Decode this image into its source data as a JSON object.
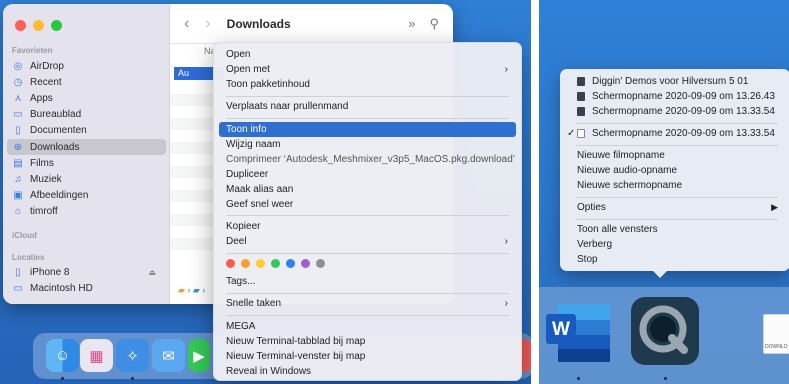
{
  "finder": {
    "title": "Downloads",
    "nav_back": "‹",
    "nav_forward": "›",
    "toolbar_more": "»",
    "column_header": "Naa",
    "selected_file": "Au",
    "sidebar": {
      "favorites_header": "Favorieten",
      "items": [
        {
          "label": "AirDrop",
          "icon": "◎"
        },
        {
          "label": "Recent",
          "icon": "◷"
        },
        {
          "label": "Apps",
          "icon": "⋏"
        },
        {
          "label": "Bureaublad",
          "icon": "▭"
        },
        {
          "label": "Documenten",
          "icon": "▯"
        },
        {
          "label": "Downloads",
          "icon": "⊕"
        },
        {
          "label": "Films",
          "icon": "▤"
        },
        {
          "label": "Muziek",
          "icon": "♫"
        },
        {
          "label": "Afbeeldingen",
          "icon": "▣"
        },
        {
          "label": "timroff",
          "icon": "⌂"
        }
      ],
      "icloud_header": "iCloud",
      "locations_header": "Locaties",
      "locations": [
        {
          "label": "iPhone 8",
          "icon": "▯"
        },
        {
          "label": "Macintosh HD",
          "icon": "▭"
        }
      ]
    }
  },
  "context_menu": {
    "items": {
      "open": "Open",
      "open_with": "Open met",
      "show_package": "Toon pakketinhoud",
      "move_to_trash": "Verplaats naar prullenmand",
      "get_info": "Toon info",
      "rename": "Wijzig naam",
      "compress": "Comprimeer ‘Autodesk_Meshmixer_v3p5_MacOS.pkg.download’",
      "duplicate": "Dupliceer",
      "make_alias": "Maak alias aan",
      "quick_look": "Geef snel weer",
      "copy": "Kopieer",
      "share": "Deel",
      "tags": "Tags...",
      "quick_actions": "Snelle taken",
      "mega": "MEGA",
      "new_terminal_tab": "Nieuw Terminal-tabblad bij map",
      "new_terminal_window": "Nieuw Terminal-venster bij map",
      "reveal_windows": "Reveal in Windows"
    },
    "tag_colors": [
      "#ff5a4f",
      "#ff9b2f",
      "#ffcc2e",
      "#34c759",
      "#2f7ef6",
      "#a35bd6",
      "#8e8e93"
    ],
    "submenu_arrow": "›"
  },
  "quicktime_menu": {
    "recent_files": [
      "Diggin' Demos voor Hilversum 5 01",
      "Schermopname 2020-09-09 om 13.26.43",
      "Schermopname 2020-09-09 om 13.33.54"
    ],
    "current_window": "Schermopname 2020-09-09 om 13.33.54",
    "checkmark": "✓",
    "new_items": [
      "Nieuwe filmopname",
      "Nieuwe audio-opname",
      "Nieuwe schermopname"
    ],
    "options": "Opties",
    "options_arrow": "▶",
    "show_all": "Toon alle vensters",
    "hide": "Verberg",
    "quit": "Stop"
  },
  "dock": {
    "word_letter": "W",
    "doc_label": "DOWNLO"
  },
  "colors": {
    "accent": "#2f6fd0",
    "desktop": "#2a6fc4"
  }
}
